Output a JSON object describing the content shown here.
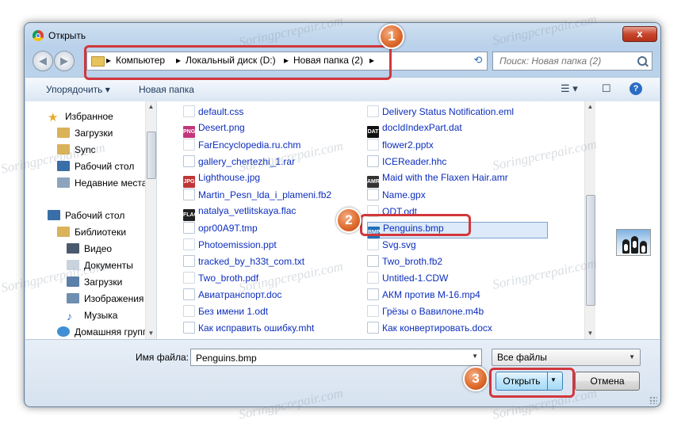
{
  "window": {
    "title": "Открыть",
    "close_label": "x"
  },
  "nav": {
    "back_label": "◀",
    "forward_label": "▶"
  },
  "address": {
    "crumbs": [
      "Компьютер",
      "Локальный диск (D:)",
      "Новая папка (2)"
    ],
    "separator": "▸",
    "refresh_label": "⟲"
  },
  "search": {
    "placeholder": "Поиск: Новая папка (2)"
  },
  "toolbar": {
    "organize_label": "Упорядочить ▾",
    "new_folder_label": "Новая папка",
    "view_label": "☰ ▾",
    "preview_label": "☐",
    "help_label": "?"
  },
  "sidebar": {
    "items": [
      {
        "label": "Избранное",
        "icon": "star-icon"
      },
      {
        "label": "Загрузки",
        "icon": "downloads-folder-icon"
      },
      {
        "label": "Sync",
        "icon": "sync-folder-icon"
      },
      {
        "label": "Рабочий стол",
        "icon": "desktop-icon"
      },
      {
        "label": "Недавние места",
        "icon": "recent-places-icon"
      },
      {
        "label": "Рабочий стол",
        "icon": "desktop-icon"
      },
      {
        "label": "Библиотеки",
        "icon": "libraries-icon"
      },
      {
        "label": "Видео",
        "icon": "video-icon"
      },
      {
        "label": "Документы",
        "icon": "documents-icon"
      },
      {
        "label": "Загрузки",
        "icon": "downloads-folder-icon"
      },
      {
        "label": "Изображения",
        "icon": "pictures-icon"
      },
      {
        "label": "Музыка",
        "icon": "music-icon"
      },
      {
        "label": "Домашняя группа",
        "icon": "homegroup-icon"
      }
    ]
  },
  "files": {
    "col1": [
      {
        "name": "default.css",
        "icon": "css-file-icon"
      },
      {
        "name": "Desert.png",
        "icon": "png-file-icon",
        "tag": "PNG"
      },
      {
        "name": "FarEncyclopedia.ru.chm",
        "icon": "chm-file-icon"
      },
      {
        "name": "gallery_chertezhi_1.rar",
        "icon": "rar-file-icon"
      },
      {
        "name": "Lighthouse.jpg",
        "icon": "jpg-file-icon",
        "tag": "JPG"
      },
      {
        "name": "Martin_Pesn_lda_i_plameni.fb2",
        "icon": "fb2-file-icon"
      },
      {
        "name": "natalya_vetlitskaya.flac",
        "icon": "flac-file-icon",
        "tag": "FLAC"
      },
      {
        "name": "opr00A9T.tmp",
        "icon": "tmp-file-icon"
      },
      {
        "name": "Photoemission.ppt",
        "icon": "ppt-file-icon"
      },
      {
        "name": "tracked_by_h33t_com.txt",
        "icon": "txt-file-icon"
      },
      {
        "name": "Two_broth.pdf",
        "icon": "pdf-file-icon"
      },
      {
        "name": "Авиатранспорт.doc",
        "icon": "doc-file-icon"
      },
      {
        "name": "Без имени 1.odt",
        "icon": "odt-file-icon"
      },
      {
        "name": "Как исправить ошибку.mht",
        "icon": "mht-file-icon"
      }
    ],
    "col2": [
      {
        "name": "Delivery Status Notification.eml",
        "icon": "eml-file-icon"
      },
      {
        "name": "docIdIndexPart.dat",
        "icon": "dat-file-icon",
        "tag": "DAT"
      },
      {
        "name": "flower2.pptx",
        "icon": "pptx-file-icon"
      },
      {
        "name": "ICEReader.hhc",
        "icon": "hhc-file-icon"
      },
      {
        "name": "Maid with the Flaxen Hair.amr",
        "icon": "amr-file-icon",
        "tag": "AMR"
      },
      {
        "name": "Name.gpx",
        "icon": "gpx-file-icon"
      },
      {
        "name": "ODT.odt",
        "icon": "odt-file-icon"
      },
      {
        "name": "Penguins.bmp",
        "icon": "bmp-file-icon",
        "tag": "BMP",
        "selected": true
      },
      {
        "name": "Svg.svg",
        "icon": "svg-file-icon"
      },
      {
        "name": "Two_broth.fb2",
        "icon": "fb2-file-icon"
      },
      {
        "name": "Untitled-1.CDW",
        "icon": "cdw-file-icon"
      },
      {
        "name": "АКМ против М-16.mp4",
        "icon": "mp4-file-icon"
      },
      {
        "name": "Грёзы о Вавилоне.m4b",
        "icon": "m4b-file-icon"
      },
      {
        "name": "Как конвертировать.docx",
        "icon": "docx-file-icon"
      }
    ]
  },
  "bottom": {
    "filename_label": "Имя файла:",
    "filename_value": "Penguins.bmp",
    "filetype_value": "Все файлы",
    "open_label": "Открыть",
    "cancel_label": "Отмена"
  },
  "annotations": {
    "step1": "1",
    "step2": "2",
    "step3": "3"
  },
  "watermark": "Soringpcrepair.com",
  "colors": {
    "annotation_red": "#d2373c",
    "badge_orange": "#e06d2e",
    "link_blue": "#0d2ebd"
  }
}
